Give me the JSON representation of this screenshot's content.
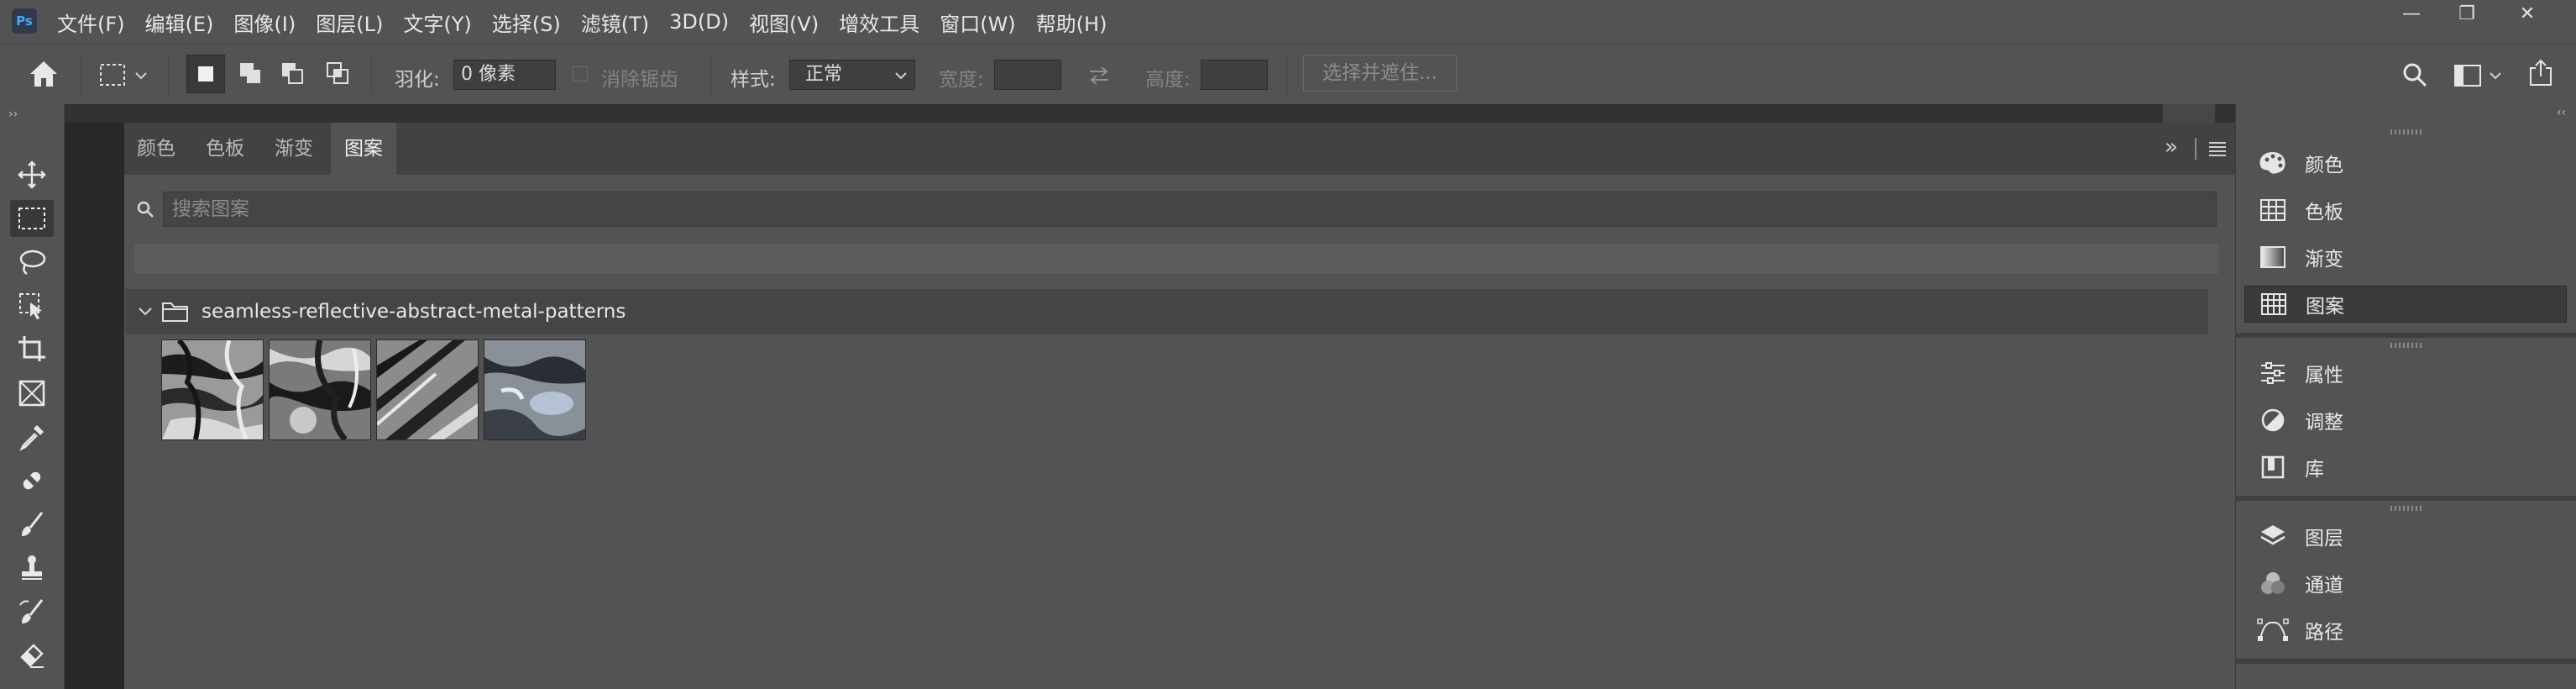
{
  "app": {
    "logo": "Ps"
  },
  "menu": [
    "文件(F)",
    "编辑(E)",
    "图像(I)",
    "图层(L)",
    "文字(Y)",
    "选择(S)",
    "滤镜(T)",
    "3D(D)",
    "视图(V)",
    "增效工具",
    "窗口(W)",
    "帮助(H)"
  ],
  "window_controls": {
    "minimize": "—",
    "restore": "❐",
    "close": "✕"
  },
  "options": {
    "feather_label": "羽化:",
    "feather_value": "0 像素",
    "antialias_label": "消除锯齿",
    "style_label": "样式:",
    "style_value": "正常",
    "width_label": "宽度:",
    "height_label": "高度:",
    "select_mask_label": "选择并遮住..."
  },
  "panel": {
    "tabs": [
      "颜色",
      "色板",
      "渐变",
      "图案"
    ],
    "active_tab": 3,
    "search_placeholder": "搜索图案",
    "group_name": "seamless-reflective-abstract-metal-patterns",
    "pattern_count": 4
  },
  "right_dock": {
    "group1": [
      "颜色",
      "色板",
      "渐变",
      "图案"
    ],
    "group2": [
      "属性",
      "调整",
      "库"
    ],
    "group3": [
      "图层",
      "通道",
      "路径"
    ],
    "active_item": "图案"
  },
  "icons": [
    "photoshop-logo",
    "home-icon",
    "rect-marquee-icon",
    "new-selection-icon",
    "add-selection-icon",
    "subtract-selection-icon",
    "intersect-selection-icon",
    "swap-icon",
    "search-icon",
    "workspace-icon",
    "share-icon",
    "move-icon",
    "lasso-icon",
    "object-select-icon",
    "crop-icon",
    "frame-icon",
    "eyedropper-icon",
    "healing-icon",
    "brush-icon",
    "stamp-icon",
    "history-brush-icon",
    "eraser-icon",
    "folder-icon",
    "palette-icon",
    "grid-icon",
    "gradient-icon",
    "pattern-icon",
    "properties-icon",
    "adjustments-icon",
    "library-icon",
    "layers-icon",
    "channels-icon",
    "paths-icon"
  ],
  "colors": {
    "chrome": "#535353",
    "dark": "#282828",
    "tabbar": "#424242",
    "accent_logo": "#48a8f5"
  }
}
